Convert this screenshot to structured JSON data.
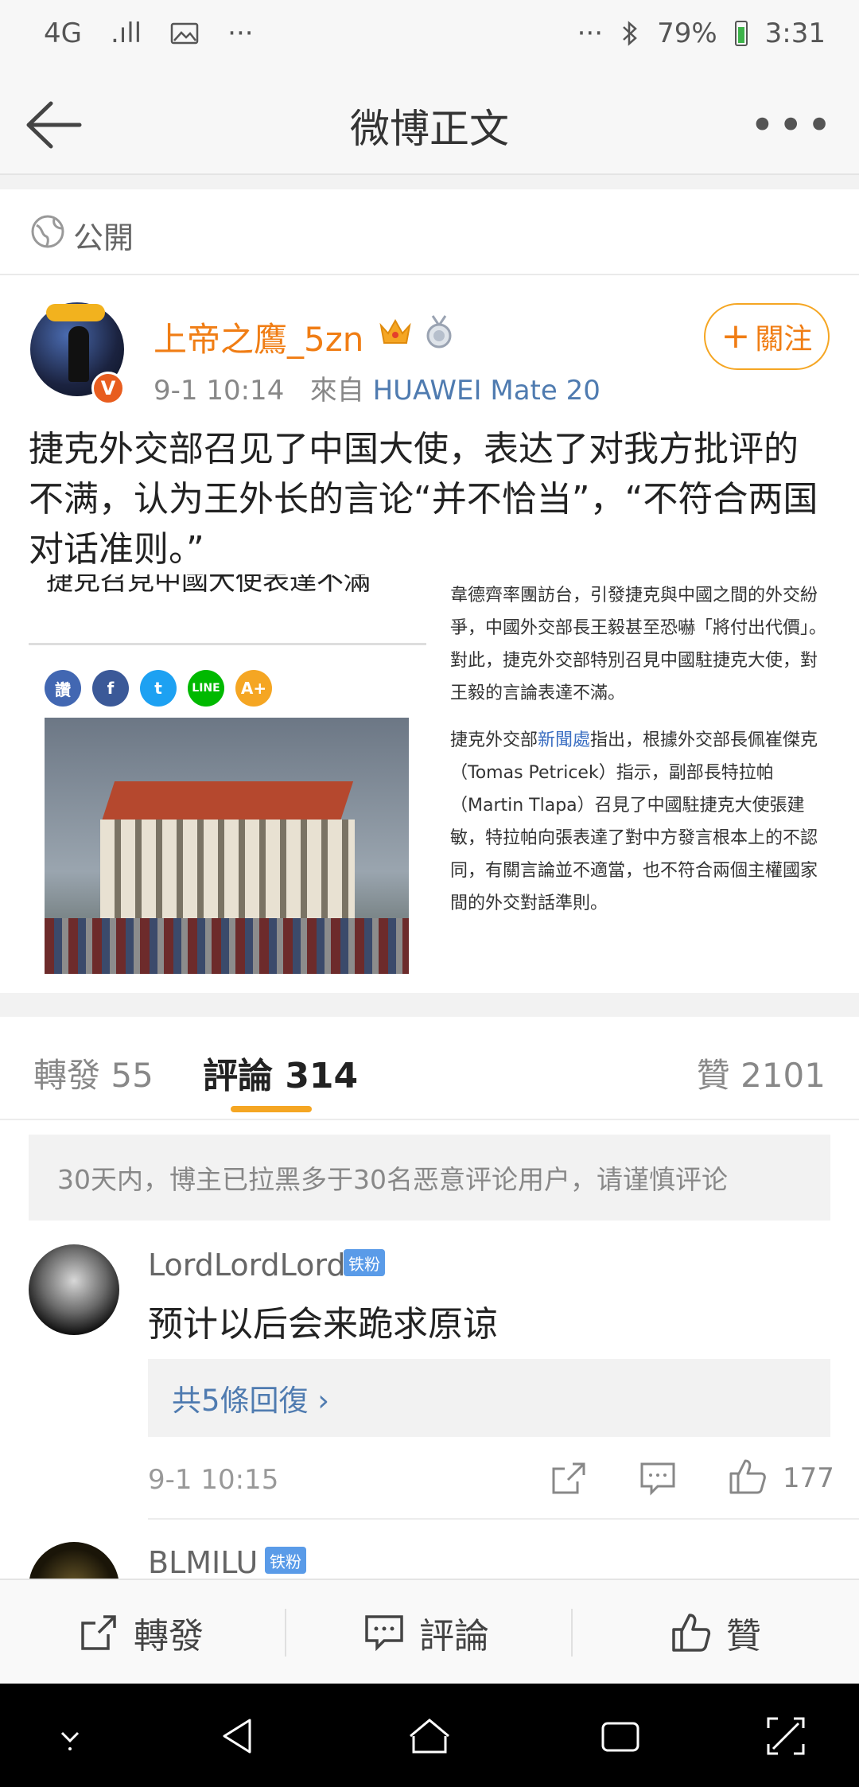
{
  "status_bar": {
    "network": "4G",
    "signal": ".ıll",
    "overflow": "···",
    "right_overflow": "···",
    "battery_percent": "79%",
    "time": "3:31"
  },
  "nav": {
    "title": "微博正文",
    "more": "•••"
  },
  "visibility": "公開",
  "author": {
    "name": "上帝之鷹_5zn",
    "verified_badge": "V",
    "timestamp": "9-1 10:14",
    "source_prefix": "來自",
    "source": "HUAWEI Mate 20",
    "follow_label": "關注"
  },
  "post": {
    "text": "捷克外交部召见了中国大使，表达了对我方批评的不满，认为王外长的言论“并不恰当”，“不符合两国对话准则。”"
  },
  "embedded_image": {
    "headline": "捷克召見中國大使表達不滿",
    "share_icons": [
      "讚",
      "f",
      "t",
      "LINE",
      "A+"
    ],
    "paragraph1": "韋德齊率團訪台，引發捷克與中國之間的外交紛爭，中國外交部長王毅甚至恐嚇「將付出代價」。對此，捷克外交部特別召見中國駐捷克大使，對王毅的言論表達不滿。",
    "p2_a": "捷克外交部",
    "p2_highlight": "新聞處",
    "p2_b": "指出，根據外交部長佩崔傑克（Tomas Petricek）指示，副部長特拉帕（Martin Tlapa）召見了中國駐捷克大使張建敏，特拉帕向張表達了對中方發言根本上的不認同，有關言論並不適當，也不符合兩個主權國家間的外交對話準則。"
  },
  "tabs": {
    "repost": "轉發 55",
    "comments": "評論 314",
    "likes": "贊 2101"
  },
  "notice": "30天内，博主已拉黑多于30名恶意评论用户，请谨慎评论",
  "comments": [
    {
      "name": "LordLordLord",
      "badge": "铁粉",
      "text": "预计以后会来跪求原谅",
      "replies": "共5條回復 ›",
      "time": "9-1 10:15",
      "likes": "177"
    },
    {
      "name": "BLMILU",
      "badge": "铁粉"
    }
  ],
  "actions": {
    "repost": "轉發",
    "comment": "評論",
    "like": "贊"
  }
}
